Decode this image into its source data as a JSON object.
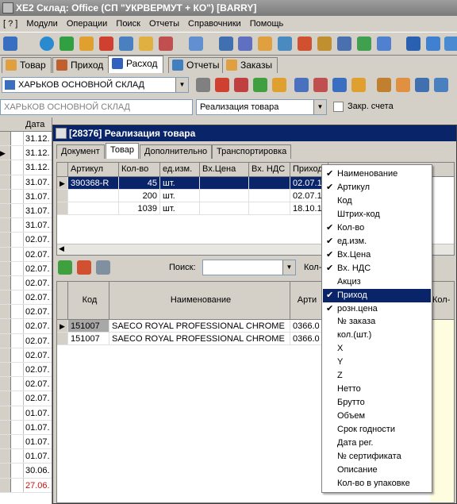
{
  "window": {
    "title": "XE2  Склад: Office (СП \"УКРВЕРМУТ + КО\") [BARRY]"
  },
  "menu": [
    "[ ? ]",
    "Модули",
    "Операции",
    "Поиск",
    "Отчеты",
    "Справочники",
    "Помощь"
  ],
  "main_tabs": [
    {
      "label": "Товар",
      "color": "#e0a040"
    },
    {
      "label": "Приход",
      "color": "#c06030"
    },
    {
      "label": "Расход",
      "color": "#3060c0"
    },
    {
      "label": "Отчеты",
      "color": "#4080c0"
    },
    {
      "label": "Заказы",
      "color": "#e0a040"
    }
  ],
  "filters": {
    "warehouse_select": "ХАРЬКОВ ОСНОВНОЙ СКЛАД",
    "warehouse_field": "ХАРЬКОВ ОСНОВНОЙ СКЛАД",
    "operation_select": "Реализация товара",
    "close_accounts_label": "Закр. счета"
  },
  "left_grid": {
    "header": "Дата",
    "rows": [
      "31.12.",
      "31.12.",
      "31.12.",
      "31.07.",
      "31.07.",
      "31.07.",
      "31.07.",
      "02.07.",
      "02.07.",
      "02.07.",
      "02.07.",
      "02.07.",
      "02.07.",
      "02.07.",
      "02.07.",
      "02.07.",
      "02.07.",
      "02.07.",
      "02.07.",
      "01.07.",
      "01.07.",
      "01.07.",
      "01.07.",
      "30.06.",
      "27.06."
    ],
    "last_row_color": "#d01010"
  },
  "doc_window": {
    "title": "[28376] Реализация товара",
    "tabs": [
      "Документ",
      "Товар",
      "Дополнительно",
      "Транспортировка"
    ],
    "items_grid": {
      "columns": [
        "Артикул",
        "Кол-во",
        "ед.изм.",
        "Вх.Цена",
        "Вх. НДС",
        "Приход"
      ],
      "rows": [
        {
          "article": "390368-R",
          "qty": "45",
          "unit": "шт.",
          "price": "",
          "vat": "",
          "income": "02.07.13"
        },
        {
          "article": "",
          "qty": "200",
          "unit": "шт.",
          "price": "",
          "vat": "",
          "income": "02.07.13"
        },
        {
          "article": "",
          "qty": "1039",
          "unit": "шт.",
          "price": "",
          "vat": "",
          "income": "18.10.12"
        }
      ]
    },
    "search_label": "Поиск:",
    "qty_label": "Кол-",
    "product_grid": {
      "columns": [
        "Код",
        "Наименование",
        "Арти",
        "Кол-"
      ],
      "rows": [
        {
          "code": "151007",
          "name": "SAECO ROYAL PROFESSIONAL CHROME",
          "art": "0366.0"
        },
        {
          "code": "151007",
          "name": "SAECO ROYAL PROFESSIONAL CHROME",
          "art": "0366.0"
        }
      ]
    }
  },
  "column_menu": {
    "items": [
      {
        "label": "Наименование",
        "checked": true
      },
      {
        "label": "Артикул",
        "checked": true
      },
      {
        "label": "Код",
        "checked": false
      },
      {
        "label": "Штрих-код",
        "checked": false
      },
      {
        "label": "Кол-во",
        "checked": true
      },
      {
        "label": "ед.изм.",
        "checked": true
      },
      {
        "label": "Вх.Цена",
        "checked": true
      },
      {
        "label": "Вх. НДС",
        "checked": true
      },
      {
        "label": "Акциз",
        "checked": false
      },
      {
        "label": "Приход",
        "checked": true,
        "highlighted": true
      },
      {
        "label": "розн.цена",
        "checked": true
      },
      {
        "label": "№ заказа",
        "checked": false
      },
      {
        "label": "кол.(шт.)",
        "checked": false
      },
      {
        "label": "X",
        "checked": false
      },
      {
        "label": "Y",
        "checked": false
      },
      {
        "label": "Z",
        "checked": false
      },
      {
        "label": "Нетто",
        "checked": false
      },
      {
        "label": "Брутто",
        "checked": false
      },
      {
        "label": "Объем",
        "checked": false
      },
      {
        "label": "Срок годности",
        "checked": false
      },
      {
        "label": "Дата рег.",
        "checked": false
      },
      {
        "label": "№ сертификата",
        "checked": false
      },
      {
        "label": "Описание",
        "checked": false
      },
      {
        "label": "Кол-во в упаковке",
        "checked": false
      }
    ]
  }
}
